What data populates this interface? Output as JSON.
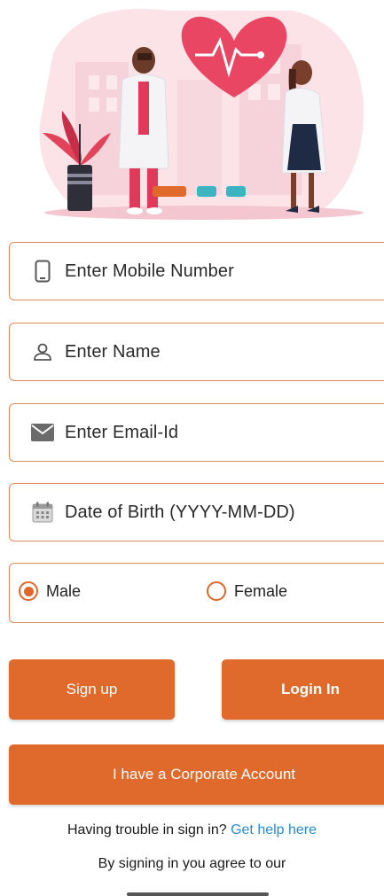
{
  "form": {
    "mobile_placeholder": "Enter Mobile Number",
    "name_placeholder": "Enter Name",
    "email_placeholder": "Enter Email-Id",
    "dob_placeholder": "Date of Birth (YYYY-MM-DD)"
  },
  "gender": {
    "male_label": "Male",
    "female_label": "Female",
    "selected": "Male"
  },
  "buttons": {
    "signup_label": "Sign up",
    "login_label": "Login In",
    "corporate_label": "I have a Corporate Account"
  },
  "footer": {
    "trouble_text": "Having trouble in sign in?",
    "help_link": "Get help here",
    "agree_text": "By signing in you agree to our"
  },
  "colors": {
    "accent": "#e06a2c",
    "border": "#de8b5a",
    "link": "#2a8bd0"
  },
  "icons": {
    "mobile": "phone-icon",
    "name": "person-icon",
    "email": "envelope-icon",
    "dob": "calendar-icon"
  }
}
